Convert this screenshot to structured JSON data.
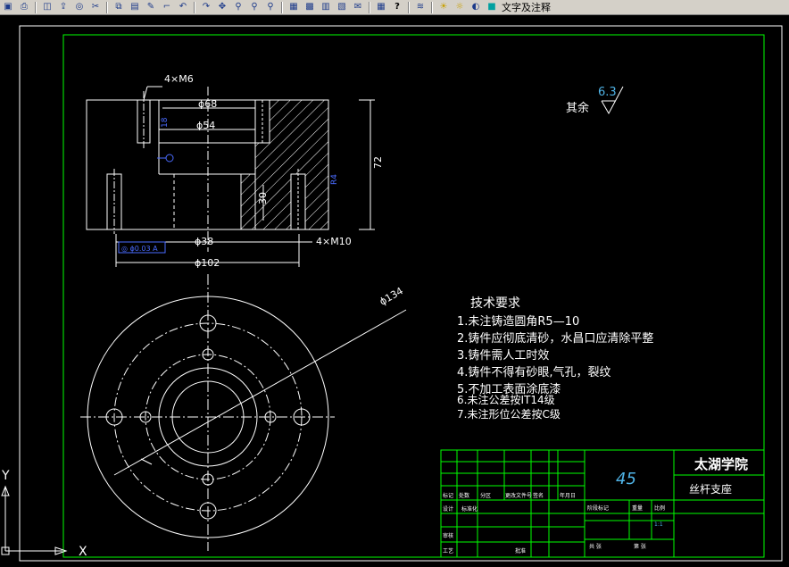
{
  "toolbar": {
    "icons": [
      "save-icon",
      "print-icon",
      "preview-icon",
      "publish-icon",
      "plot-icon",
      "cut-icon",
      "copy-icon",
      "paste-icon",
      "match-prop-icon",
      "brush-icon",
      "undo-icon",
      "redo-icon",
      "pan-icon",
      "zoom-realtime-icon",
      "zoom-window-icon",
      "zoom-previous-icon",
      "properties-icon",
      "design-center-icon",
      "tool-palette-icon",
      "sheet-set-icon",
      "markup-icon",
      "calculator-icon",
      "help-icon",
      "layer-icon",
      "bulb-icon",
      "sun-icon",
      "lock-icon",
      "color-icon"
    ],
    "layer_name": "文字及注释"
  },
  "colors": {
    "background": "#000000",
    "lines": "#ffffff",
    "border": "#00ff00",
    "dimension": "#ffffff",
    "hatch": "#ffffff",
    "blue_text": "#4a6bff",
    "cyan_text": "#4fb3e6"
  },
  "drawing": {
    "dims": {
      "thread_top": "4×M6",
      "thread_bottom": "4×M10",
      "d68": "ϕ68",
      "d54": "ϕ54",
      "d38": "ϕ38",
      "d102": "ϕ102",
      "d134": "ϕ134",
      "h72": "72",
      "h30": "30",
      "small_1": "18",
      "small_2": "R4",
      "gdt": "◎ ϕ0.03 A"
    },
    "roughness_label": "其余",
    "roughness_value": "6.3",
    "tech": {
      "title": "技术要求",
      "items": [
        "1.未注铸造圆角R5—10",
        "2.铸件应彻底清砂，水昌口应清除平整",
        "3.铸件需人工时效",
        "4.铸件不得有砂眼,气孔，裂纹",
        "5.不加工表面涂底漆",
        "6.未注公差按IT14级",
        "7.未注形位公差按C级"
      ]
    },
    "title_block": {
      "material": "45",
      "school": "太湖学院",
      "part_name": "丝杆支座",
      "labels_row1": [
        "标记",
        "处数",
        "分区",
        "更改文件号",
        "签名",
        "年月日"
      ],
      "labels_row2": [
        "设计",
        "标准化",
        "阶段标记",
        "重量",
        "比例"
      ],
      "labels_row3": [
        "审核"
      ],
      "labels_row4": [
        "工艺",
        "批准",
        "共 张",
        "第 张"
      ],
      "scale": "1:1"
    },
    "ucs": {
      "x_label": "X",
      "y_label": "Y"
    }
  }
}
